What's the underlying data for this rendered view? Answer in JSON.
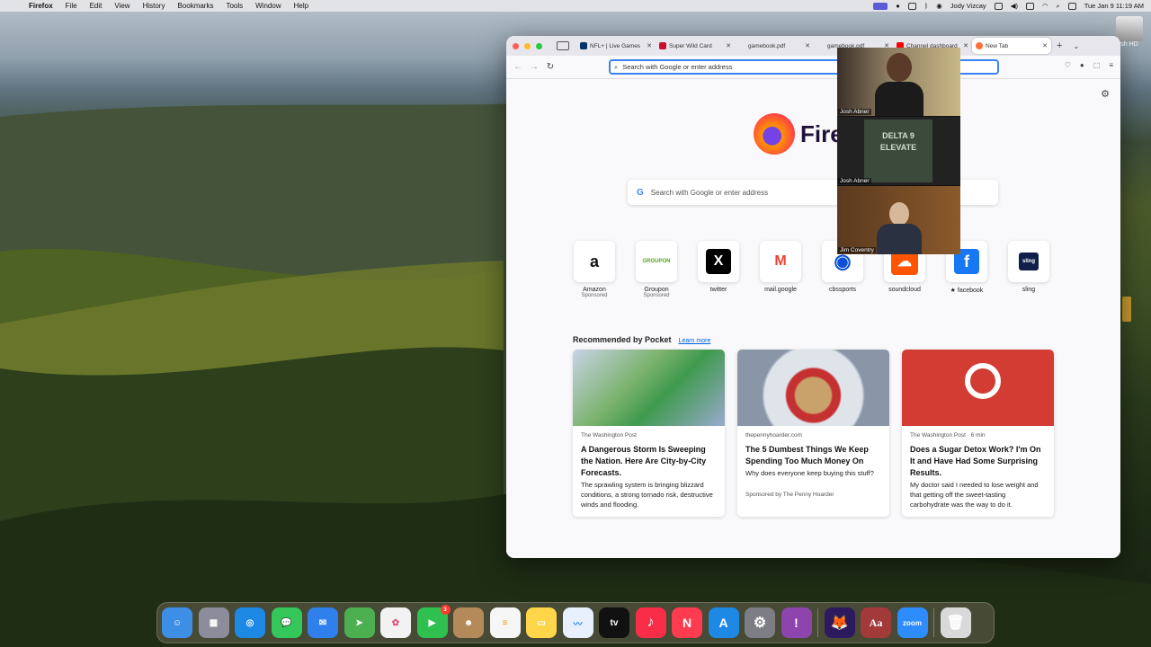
{
  "menubar": {
    "app_name": "Firefox",
    "items": [
      "File",
      "Edit",
      "View",
      "History",
      "Bookmarks",
      "Tools",
      "Window",
      "Help"
    ],
    "user": "Jody Vizcay",
    "clock": "Tue Jan 9  11:19 AM"
  },
  "desktop": {
    "drive_label": "sh HD"
  },
  "browser": {
    "tabs": [
      {
        "title": "NFL+ | Live Games"
      },
      {
        "title": "Super Wild Card"
      },
      {
        "title": "gamebook.pdf"
      },
      {
        "title": "gamebook.pdf"
      },
      {
        "title": "Channel dashboard"
      },
      {
        "title": "New Tab"
      }
    ],
    "url_placeholder": "Search with Google or enter address",
    "wordmark": "Fire",
    "search_placeholder": "Search with Google or enter address",
    "shortcuts": [
      {
        "name": "Amazon",
        "sponsored": "Sponsored",
        "glyph": "a"
      },
      {
        "name": "Groupon",
        "sponsored": "Sponsored",
        "glyph": "GROUPON"
      },
      {
        "name": "twitter",
        "sponsored": "",
        "glyph": "X"
      },
      {
        "name": "mail.google",
        "sponsored": "",
        "glyph": "M"
      },
      {
        "name": "cbssports",
        "sponsored": "",
        "glyph": "◉"
      },
      {
        "name": "soundcloud",
        "sponsored": "",
        "glyph": "☁"
      },
      {
        "name": "★ facebook",
        "sponsored": "",
        "glyph": "f"
      },
      {
        "name": "sling",
        "sponsored": "",
        "glyph": "sling"
      }
    ],
    "pocket": {
      "heading": "Recommended by Pocket",
      "learn_more": "Learn more",
      "cards": [
        {
          "source": "The Washington Post",
          "title": "A Dangerous Storm Is Sweeping the Nation. Here Are City-by-City Forecasts.",
          "excerpt": "The sprawling system is bringing blizzard conditions, a strong tornado risk, destructive winds and flooding.",
          "sponsor": ""
        },
        {
          "source": "thepennyhoarder.com",
          "title": "The 5 Dumbest Things We Keep Spending Too Much Money On",
          "excerpt": "Why does everyone keep buying this stuff?",
          "sponsor": "Sponsored by The Penny Hoarder"
        },
        {
          "source": "The Washington Post · 6 min",
          "title": "Does a Sugar Detox Work? I'm On It and Have Had Some Surprising Results.",
          "excerpt": "My doctor said I needed to lose weight and that getting off the sweet-tasting carbohydrate was the way to do it.",
          "sponsor": ""
        }
      ]
    }
  },
  "zoom": {
    "participants": [
      {
        "name": "Josh Abner"
      },
      {
        "name": "Josh Abner"
      },
      {
        "name": "Jim Coventry"
      }
    ],
    "sign_text": "DELTA 9 ELEVATE"
  },
  "dock": {
    "apps": [
      {
        "name": "Finder",
        "color": "#3d8fe6",
        "glyph": "☺"
      },
      {
        "name": "Launchpad",
        "color": "#8c8c9a",
        "glyph": "▦"
      },
      {
        "name": "Safari",
        "color": "#1e88e5",
        "glyph": "◎"
      },
      {
        "name": "Messages",
        "color": "#34c759",
        "glyph": "💬"
      },
      {
        "name": "Mail",
        "color": "#2f80ed",
        "glyph": "✉"
      },
      {
        "name": "Maps",
        "color": "#4caf50",
        "glyph": "➤"
      },
      {
        "name": "Photos",
        "color": "#f2f2f2",
        "glyph": "✿"
      },
      {
        "name": "FaceTime",
        "color": "#30c04f",
        "glyph": "▶",
        "badge": "3"
      },
      {
        "name": "Contacts",
        "color": "#b48a5a",
        "glyph": "☻"
      },
      {
        "name": "Reminders",
        "color": "#f6f6f6",
        "glyph": "≡"
      },
      {
        "name": "Notes",
        "color": "#ffd54a",
        "glyph": "▭"
      },
      {
        "name": "Freeform",
        "color": "#e8f0fe",
        "glyph": "〰"
      },
      {
        "name": "TV",
        "color": "#111",
        "glyph": "tv"
      },
      {
        "name": "Music",
        "color": "#fa2d48",
        "glyph": "♪"
      },
      {
        "name": "News",
        "color": "#ff3b4f",
        "glyph": "N"
      },
      {
        "name": "App Store",
        "color": "#1e88e5",
        "glyph": "A"
      },
      {
        "name": "System Settings",
        "color": "#7d7d86",
        "glyph": "⚙"
      },
      {
        "name": "Feedback",
        "color": "#8e44ad",
        "glyph": "!"
      },
      {
        "name": "Firefox",
        "color": "#2d1a5e",
        "glyph": "🦊"
      },
      {
        "name": "Dictionary",
        "color": "#a33a3a",
        "glyph": "Aa"
      },
      {
        "name": "zoom",
        "color": "#2d8cff",
        "glyph": "zoom"
      },
      {
        "name": "Trash",
        "color": "#d9d9d9",
        "glyph": "🗑"
      }
    ]
  }
}
